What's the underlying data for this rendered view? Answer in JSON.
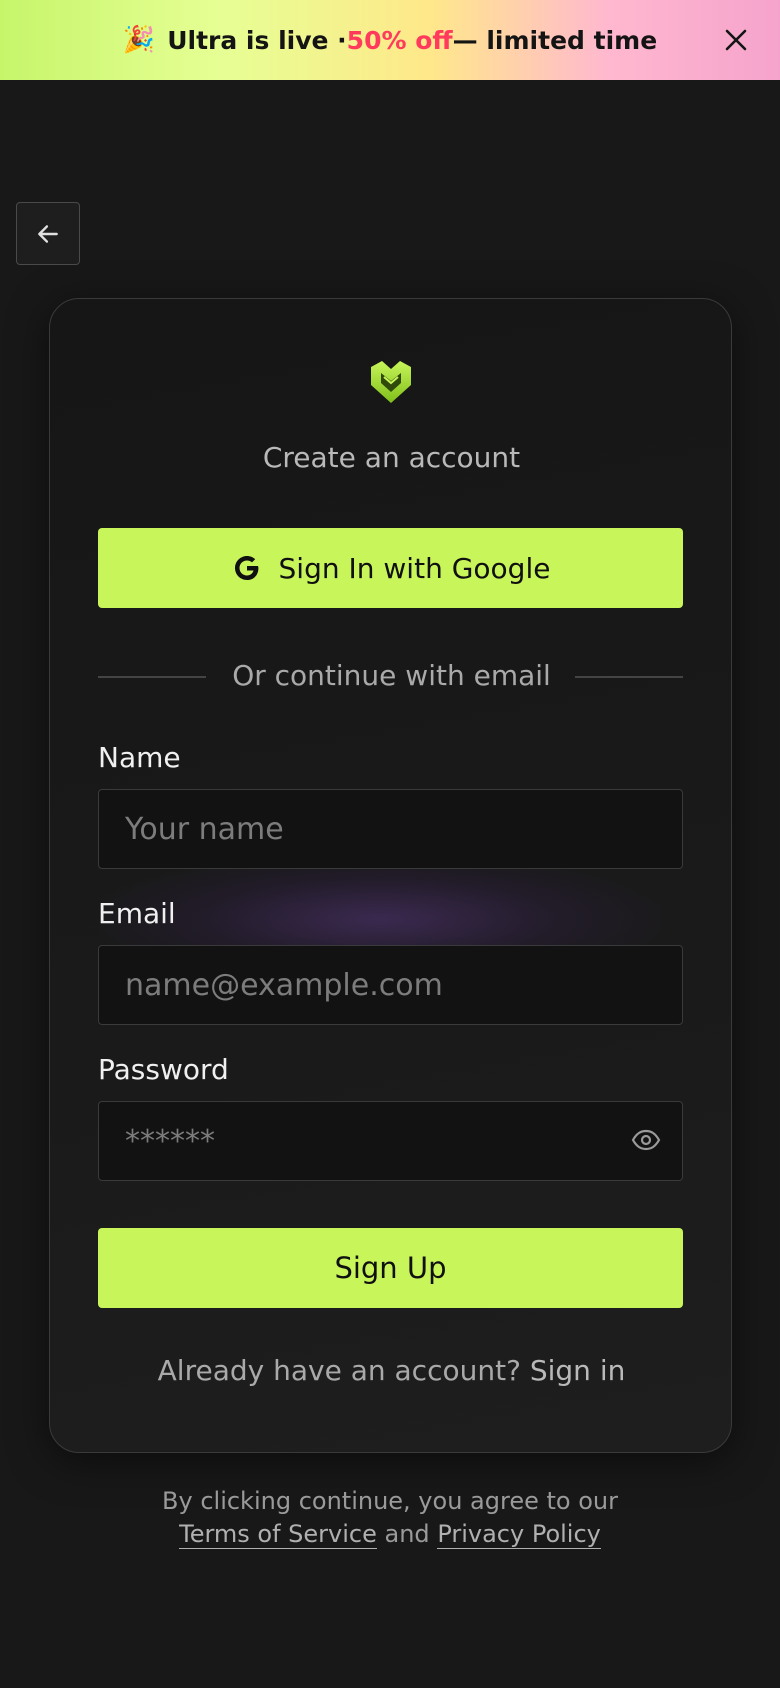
{
  "banner": {
    "emoji": "🎉",
    "text_before": "Ultra is live · ",
    "offer": "50% off",
    "text_after": " — limited time",
    "close_icon": "close-icon",
    "accent": "#ff3a5c"
  },
  "back_icon": "arrow-left-icon",
  "card": {
    "logo_icon": "shield-chevron-logo",
    "title": "Create an account",
    "google_button": "Sign In with Google",
    "divider": "Or continue with email",
    "fields": {
      "name": {
        "label": "Name",
        "placeholder": "Your name",
        "value": ""
      },
      "email": {
        "label": "Email",
        "placeholder": "name@example.com",
        "value": ""
      },
      "password": {
        "label": "Password",
        "placeholder": "******",
        "value": ""
      }
    },
    "signup_button": "Sign Up",
    "signin_prompt": "Already have an account?",
    "signin_link": "Sign in"
  },
  "legal": {
    "line1": "By clicking continue, you agree to our",
    "terms": "Terms of Service",
    "and": "and",
    "privacy": "Privacy Policy"
  },
  "colors": {
    "background": "#181818",
    "accent_green": "#c8f55a",
    "card_border": "#3a3a3a"
  }
}
